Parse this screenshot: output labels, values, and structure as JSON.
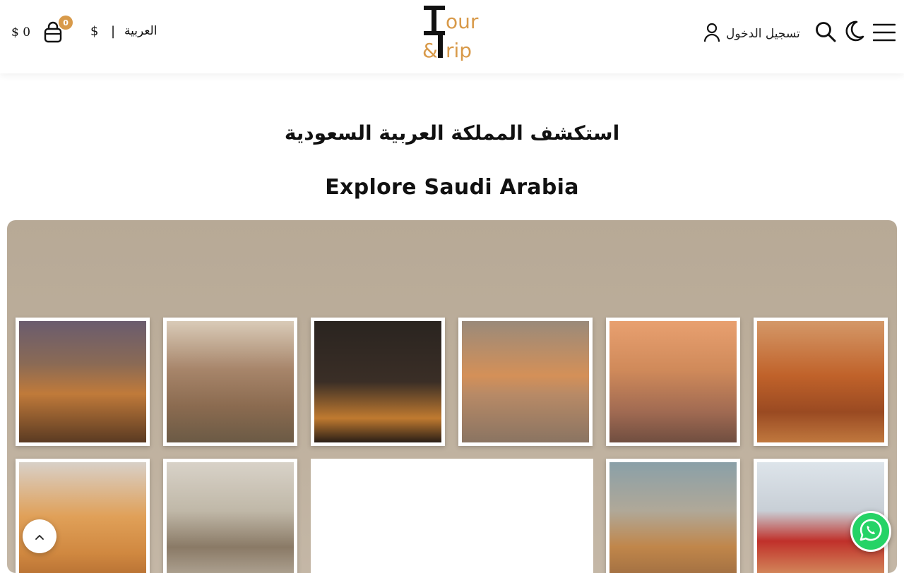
{
  "header": {
    "cart_amount": "$ 0",
    "cart_count": "0",
    "currency_symbol": "$",
    "separator": "|",
    "language": "العربية",
    "login_label": "تسجيل الدخول",
    "logo_alt": "Tour & Trip"
  },
  "main": {
    "title_ar": "استكشف المملكة العربية السعودية",
    "title_en": "Explore Saudi Arabia"
  },
  "colors": {
    "accent": "#d89a4a",
    "whatsapp": "#25d366"
  },
  "icons": [
    "cart-icon",
    "user-icon",
    "search-icon",
    "moon-icon",
    "menu-icon",
    "chevron-up-icon",
    "whatsapp-icon"
  ]
}
